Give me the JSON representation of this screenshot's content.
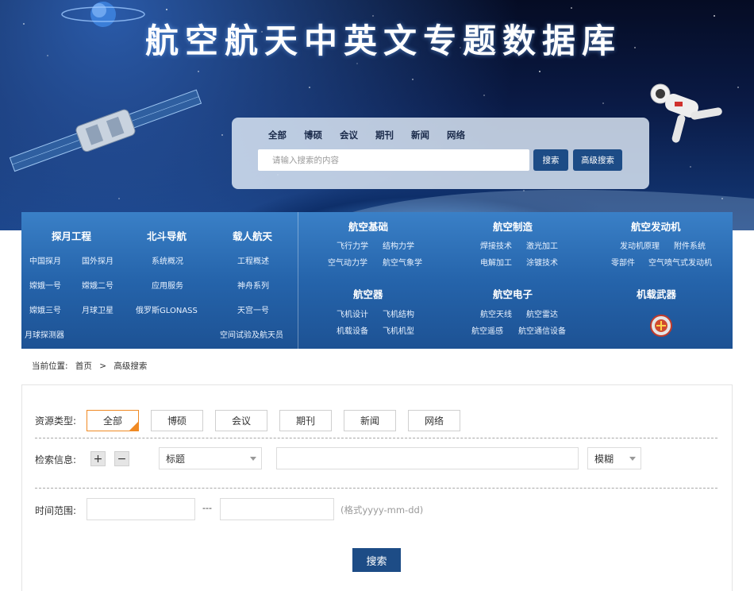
{
  "banner": {
    "title": "航空航天中英文专题数据库"
  },
  "search": {
    "tabs": [
      "全部",
      "博硕",
      "会议",
      "期刊",
      "新闻",
      "网络"
    ],
    "placeholder": "请输入搜索的内容",
    "search_label": "搜索",
    "advanced_label": "高级搜索"
  },
  "categories": {
    "left": {
      "groups": [
        {
          "title": "探月工程",
          "items": [
            "中国探月",
            "国外探月",
            "嫦娥一号",
            "嫦娥二号",
            "嫦娥三号",
            "月球卫星",
            "月球探测器"
          ]
        },
        {
          "title": "北斗导航",
          "items": [
            "系统概况",
            "应用服务",
            "俄罗斯GLONASS"
          ]
        },
        {
          "title": "载人航天",
          "items": [
            "工程概述",
            "神舟系列",
            "天宫一号",
            "空间试验及航天员"
          ]
        }
      ]
    },
    "right": {
      "groups": [
        {
          "title": "航空基础",
          "items": [
            "飞行力学",
            "结构力学",
            "空气动力学",
            "航空气象学"
          ]
        },
        {
          "title": "航空制造",
          "items": [
            "焊接技术",
            "激光加工",
            "电解加工",
            "涂镀技术"
          ]
        },
        {
          "title": "航空发动机",
          "items": [
            "发动机原理",
            "附件系统",
            "零部件",
            "空气喷气式发动机"
          ]
        },
        {
          "title": "航空器",
          "items": [
            "飞机设计",
            "飞机结构",
            "机载设备",
            "飞机机型"
          ]
        },
        {
          "title": "航空电子",
          "items": [
            "航空天线",
            "航空雷达",
            "航空遥感",
            "航空通信设备"
          ]
        },
        {
          "title": "机载武器",
          "items": []
        }
      ]
    }
  },
  "breadcrumb": {
    "label": "当前位置:",
    "home": "首页",
    "sep": ">",
    "current": "高级搜索"
  },
  "form": {
    "resource_type_label": "资源类型:",
    "types": [
      "全部",
      "博硕",
      "会议",
      "期刊",
      "新闻",
      "网络"
    ],
    "active_type": "全部",
    "query_label": "检索信息:",
    "add_symbol": "+",
    "remove_symbol": "−",
    "field_select": "标题",
    "match_select": "模糊",
    "query_value": "",
    "time_label": "时间范围:",
    "time_sep": "---",
    "time_hint": "(格式yyyy-mm-dd)",
    "start_date": "",
    "end_date": "",
    "submit_label": "搜索"
  },
  "colors": {
    "brand_blue": "#1d4c86",
    "nav_blue": "#2564ab",
    "active_orange": "#f08a24"
  }
}
